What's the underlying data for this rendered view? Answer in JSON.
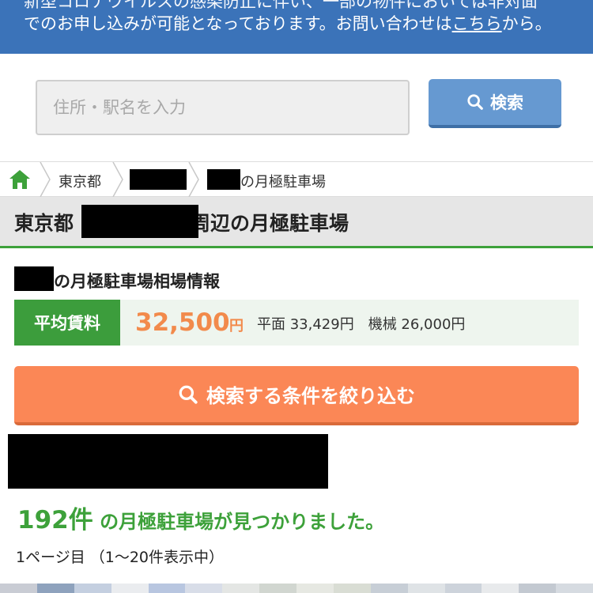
{
  "notice": {
    "line1": "新型コロナウイルスの感染防止に伴い、一部の物件においては非対面",
    "line2_before": "でのお申し込みが可能となっております。お問い合わせは",
    "line2_link": "こちら",
    "line2_after": "から。"
  },
  "search": {
    "placeholder": "住所・駅名を入力",
    "button_label": "検索"
  },
  "breadcrumb": {
    "items": [
      "東京都",
      "の月極駐車場"
    ]
  },
  "page": {
    "title_prefix": "東京都",
    "title_suffix": "周辺の月極駐車場"
  },
  "market": {
    "title": "の月極駐車場相場情報",
    "avg_label": "平均賃料",
    "avg_price": "32,500",
    "avg_unit": "円",
    "detail": "平面 33,429円　機械 26,000円"
  },
  "filter": {
    "button_label": "検索する条件を絞り込む"
  },
  "results": {
    "count": "192件",
    "count_text": " の月極駐車場が見つかりました。",
    "page_info": "1ページ目 （1〜20件表示中）"
  },
  "colors": {
    "header_blue": "#3b73b9",
    "search_button": "#6699d1",
    "green_accent": "#3da13a",
    "orange_accent": "#fb8756",
    "price_orange": "#f28a4b"
  }
}
